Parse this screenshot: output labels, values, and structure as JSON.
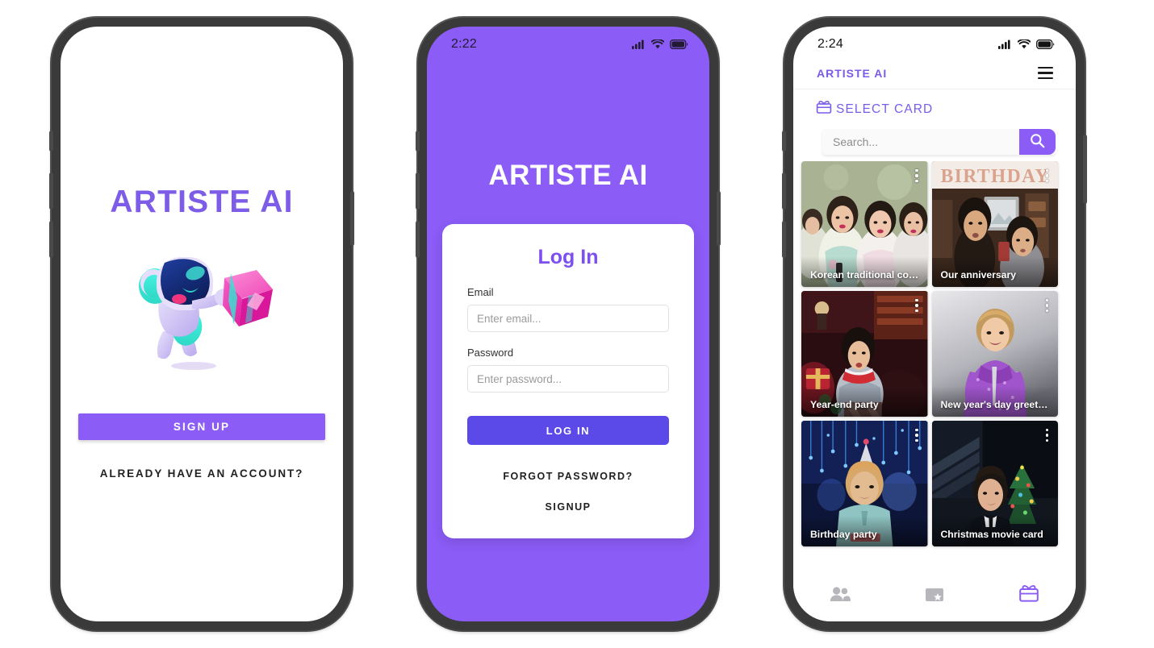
{
  "app": {
    "name": "Artiste AI"
  },
  "screens": {
    "splash": {
      "title": "ARTISTE AI",
      "mascot_icon": "robot-mascot-illustration",
      "signup_button": "SIGN UP",
      "account_link": "ALREADY HAVE AN ACCOUNT?",
      "accent_color": "#7d5ce8",
      "button_color": "#8b5cf6"
    },
    "login": {
      "status": {
        "time": "2:22",
        "cellular_icon": "cellular-signal-icon",
        "wifi_icon": "wifi-icon",
        "battery_icon": "battery-full-icon"
      },
      "brand_title": "ARTISTE AI",
      "card_heading": "Log In",
      "email_label": "Email",
      "email_placeholder": "Enter email...",
      "email_value": "",
      "password_label": "Password",
      "password_placeholder": "Enter password...",
      "password_value": "",
      "login_button": "LOG IN",
      "forgot_link": "FORGOT PASSWORD?",
      "signup_link": "SIGNUP",
      "background_color": "#8b5cf6",
      "heading_color": "#7d4ef0",
      "button_color": "#5b4ae8"
    },
    "gallery": {
      "status": {
        "time": "2:24",
        "cellular_icon": "cellular-signal-icon",
        "wifi_icon": "wifi-icon",
        "battery_icon": "battery-full-icon"
      },
      "brand": "ARTISTE AI",
      "menu_icon": "hamburger-menu-icon",
      "section_icon": "gift-card-icon",
      "section_title": "SELECT CARD",
      "search_placeholder": "Search...",
      "search_value": "",
      "search_icon": "search-icon",
      "accent_color": "#7b5ce8",
      "cards": [
        {
          "title": "Korean traditional cost...",
          "menu_icon": "kebab-menu-icon",
          "theme": "hanbok-group-green"
        },
        {
          "title": "Our anniversary",
          "menu_icon": "kebab-menu-icon",
          "theme": "birthday-banner-brown"
        },
        {
          "title": "Year-end party",
          "menu_icon": "kebab-menu-icon",
          "theme": "christmas-red-indoor"
        },
        {
          "title": "New year's day greeting",
          "menu_icon": "kebab-menu-icon",
          "theme": "purple-hanbok-gray"
        },
        {
          "title": "Birthday party",
          "menu_icon": "kebab-menu-icon",
          "theme": "party-hat-blue-lights"
        },
        {
          "title": "Christmas movie card",
          "menu_icon": "kebab-menu-icon",
          "theme": "christmas-movie-dark"
        }
      ],
      "nav": [
        {
          "icon": "people-icon",
          "active": false
        },
        {
          "icon": "movie-clapper-icon",
          "active": false
        },
        {
          "icon": "gift-card-icon",
          "active": true
        }
      ]
    }
  }
}
